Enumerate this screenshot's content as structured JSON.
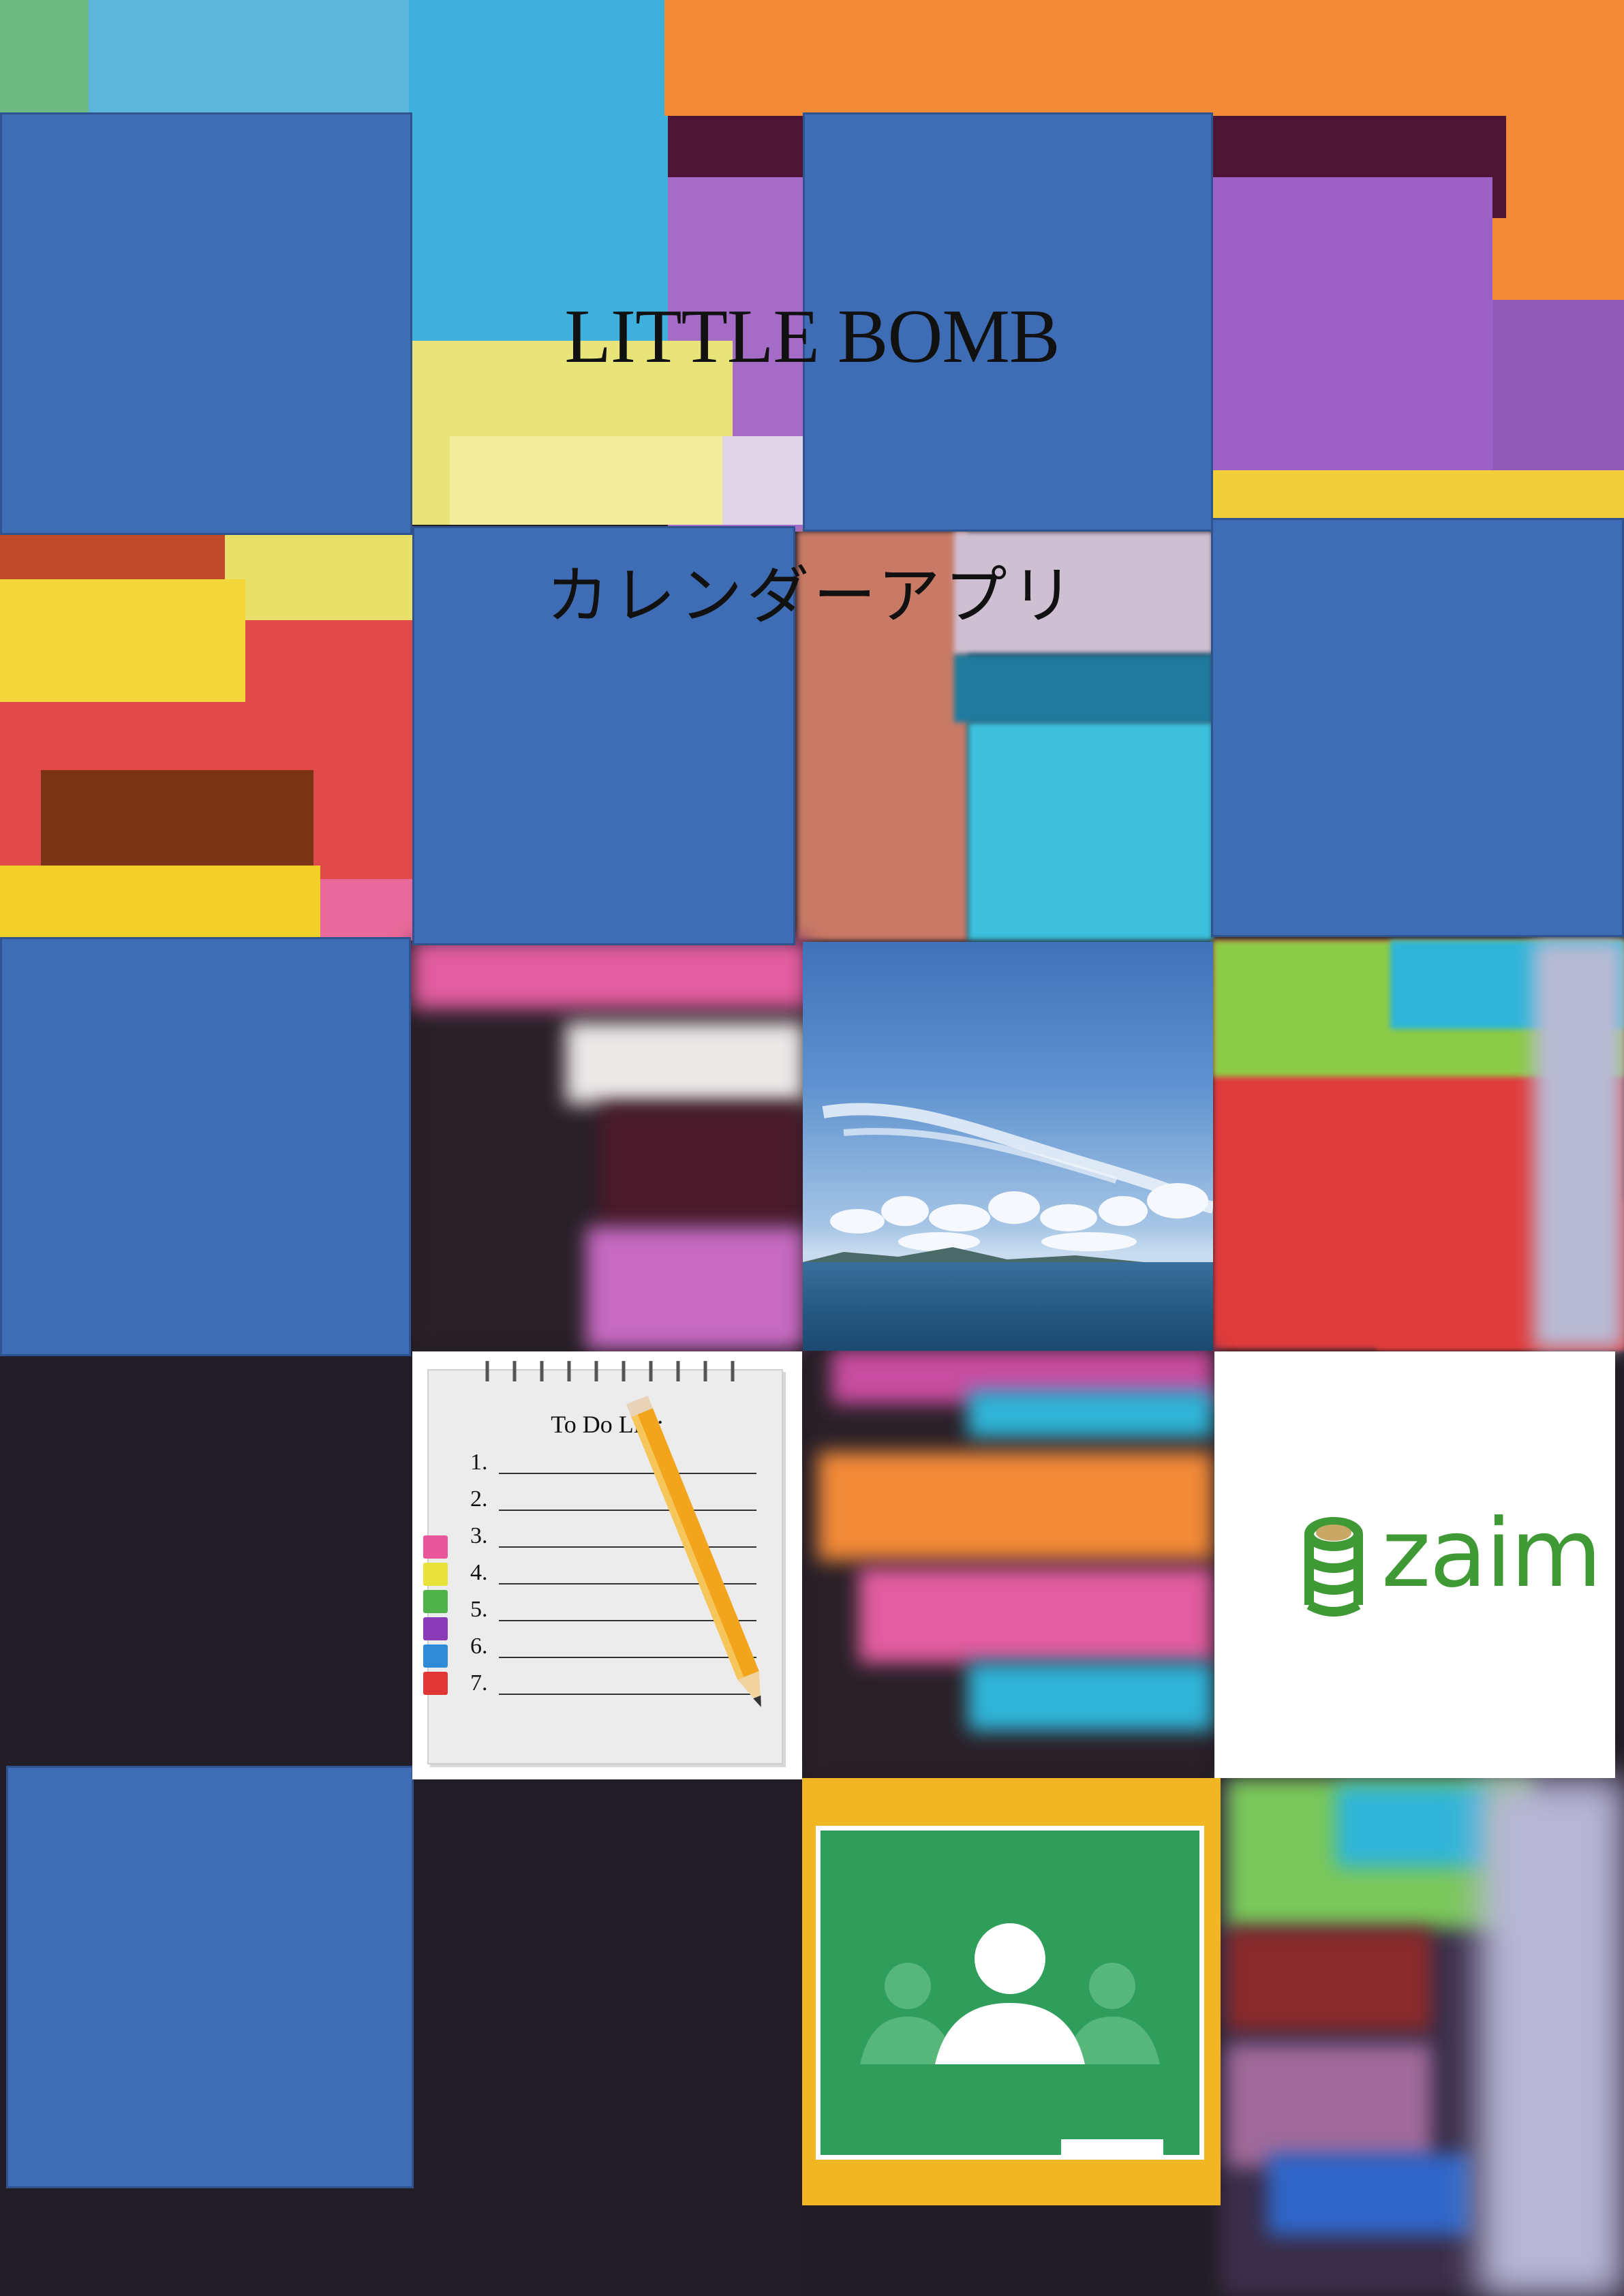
{
  "title": "LITTLE BOMB",
  "subtitle": "カレンダーアプリ",
  "todo": {
    "heading": "To Do List:",
    "items": [
      "1.",
      "2.",
      "3.",
      "4.",
      "5.",
      "6.",
      "7."
    ]
  },
  "zaim": {
    "brand": "zaim"
  },
  "colors": {
    "tile_blue": "#3f6db5",
    "zaim_green": "#3f9a35",
    "classroom_green": "#2f9e5b",
    "classroom_yellow": "#f2b625"
  },
  "icons": [
    "notepad-pencil-icon",
    "zaim-coin-stack-icon",
    "google-classroom-icon",
    "sky-sea-photo"
  ]
}
